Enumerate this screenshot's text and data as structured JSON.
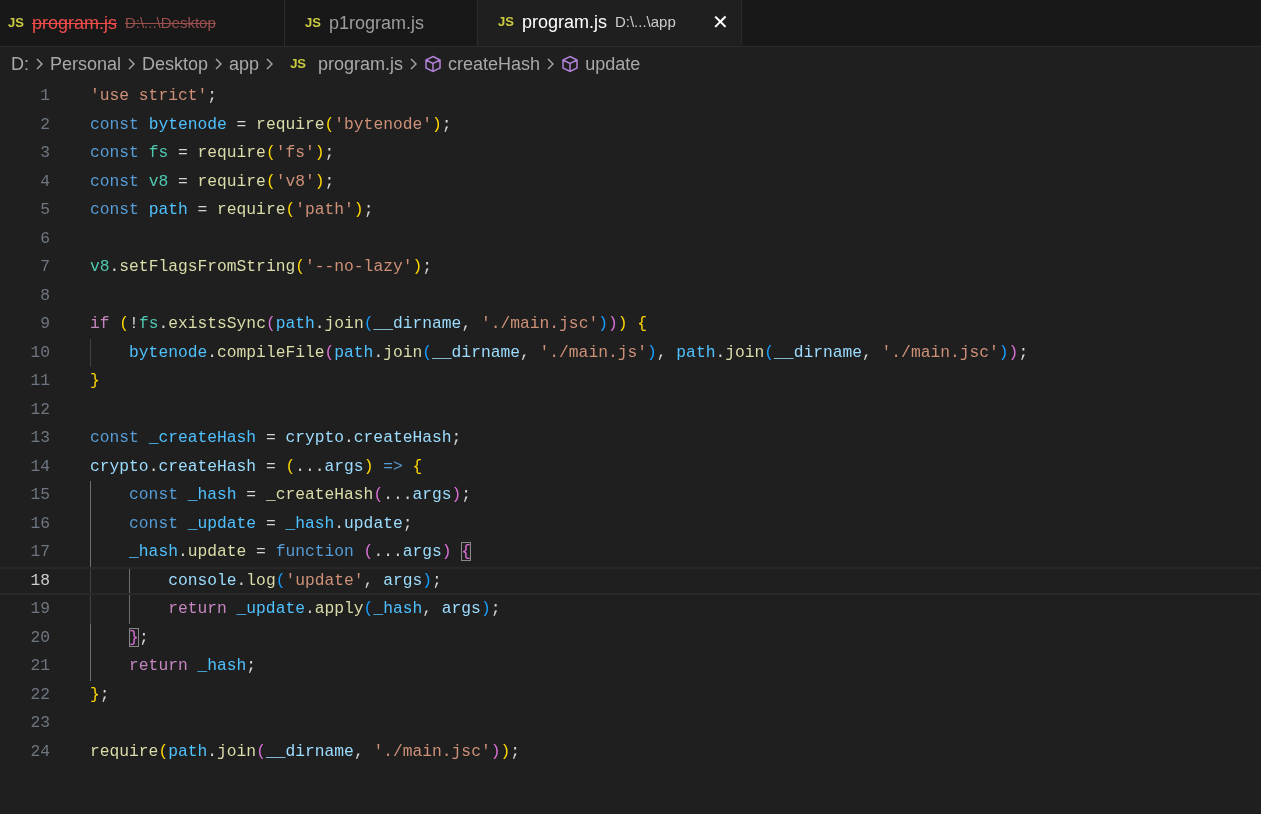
{
  "tabs": [
    {
      "icon": "JS",
      "name": "program.js",
      "path": "D:\\...\\Desktop",
      "selected": false,
      "deleted": true
    },
    {
      "icon": "JS",
      "name": "p1rogram.js",
      "selected": false,
      "deleted": false
    },
    {
      "icon": "JS",
      "name": "program.js",
      "path": "D:\\...\\app",
      "selected": true,
      "deleted": false,
      "close": "✕"
    }
  ],
  "breadcrumbs": [
    {
      "kind": "folder",
      "label": "D:"
    },
    {
      "kind": "folder",
      "label": "Personal"
    },
    {
      "kind": "folder",
      "label": "Desktop"
    },
    {
      "kind": "folder",
      "label": "app"
    },
    {
      "kind": "file",
      "icon": "JS",
      "label": "program.js"
    },
    {
      "kind": "symbol",
      "label": "createHash"
    },
    {
      "kind": "symbol",
      "label": "update"
    }
  ],
  "lines": [
    {
      "number": "1",
      "current": false,
      "tokens": [
        {
          "t": "'use strict'",
          "kind": "str"
        },
        {
          "t": ";",
          "kind": "p"
        }
      ]
    },
    {
      "number": "2",
      "current": false,
      "tokens": [
        {
          "t": "const ",
          "kind": "kw"
        },
        {
          "t": "bytenode",
          "kind": "cv"
        },
        {
          "t": " = ",
          "kind": "p"
        },
        {
          "t": "require",
          "kind": "fn"
        },
        {
          "t": "(",
          "kind": "b1"
        },
        {
          "t": "'bytenode'",
          "kind": "str"
        },
        {
          "t": ")",
          "kind": "b1"
        },
        {
          "t": ";",
          "kind": "p"
        }
      ]
    },
    {
      "number": "3",
      "current": false,
      "tokens": [
        {
          "t": "const ",
          "kind": "kw"
        },
        {
          "t": "fs",
          "kind": "ns"
        },
        {
          "t": " = ",
          "kind": "p"
        },
        {
          "t": "require",
          "kind": "fn"
        },
        {
          "t": "(",
          "kind": "b1"
        },
        {
          "t": "'fs'",
          "kind": "str"
        },
        {
          "t": ")",
          "kind": "b1"
        },
        {
          "t": ";",
          "kind": "p"
        }
      ]
    },
    {
      "number": "4",
      "current": false,
      "tokens": [
        {
          "t": "const ",
          "kind": "kw"
        },
        {
          "t": "v8",
          "kind": "ns"
        },
        {
          "t": " = ",
          "kind": "p"
        },
        {
          "t": "require",
          "kind": "fn"
        },
        {
          "t": "(",
          "kind": "b1"
        },
        {
          "t": "'v8'",
          "kind": "str"
        },
        {
          "t": ")",
          "kind": "b1"
        },
        {
          "t": ";",
          "kind": "p"
        }
      ]
    },
    {
      "number": "5",
      "current": false,
      "tokens": [
        {
          "t": "const ",
          "kind": "kw"
        },
        {
          "t": "path",
          "kind": "cv"
        },
        {
          "t": " = ",
          "kind": "p"
        },
        {
          "t": "require",
          "kind": "fn"
        },
        {
          "t": "(",
          "kind": "b1"
        },
        {
          "t": "'path'",
          "kind": "str"
        },
        {
          "t": ")",
          "kind": "b1"
        },
        {
          "t": ";",
          "kind": "p"
        }
      ]
    },
    {
      "number": "6",
      "current": false
    },
    {
      "number": "7",
      "current": false,
      "tokens": [
        {
          "t": "v8",
          "kind": "ns"
        },
        {
          "t": ".",
          "kind": "p"
        },
        {
          "t": "setFlagsFromString",
          "kind": "fn"
        },
        {
          "t": "(",
          "kind": "b1"
        },
        {
          "t": "'--no-lazy'",
          "kind": "str"
        },
        {
          "t": ")",
          "kind": "b1"
        },
        {
          "t": ";",
          "kind": "p"
        }
      ]
    },
    {
      "number": "8",
      "current": false
    },
    {
      "number": "9",
      "current": false,
      "tokens": [
        {
          "t": "if ",
          "kind": "ctl"
        },
        {
          "t": "(",
          "kind": "b1"
        },
        {
          "t": "!",
          "kind": "p"
        },
        {
          "t": "fs",
          "kind": "ns"
        },
        {
          "t": ".",
          "kind": "p"
        },
        {
          "t": "existsSync",
          "kind": "fn"
        },
        {
          "t": "(",
          "kind": "b2"
        },
        {
          "t": "path",
          "kind": "cv"
        },
        {
          "t": ".",
          "kind": "p"
        },
        {
          "t": "join",
          "kind": "fn"
        },
        {
          "t": "(",
          "kind": "b3"
        },
        {
          "t": "__dirname",
          "kind": "var"
        },
        {
          "t": ", ",
          "kind": "p"
        },
        {
          "t": "'./main.jsc'",
          "kind": "str"
        },
        {
          "t": ")",
          "kind": "b3"
        },
        {
          "t": ")",
          "kind": "b2"
        },
        {
          "t": ") ",
          "kind": "b1"
        },
        {
          "t": "{",
          "kind": "b1"
        }
      ]
    },
    {
      "number": "10",
      "current": false,
      "tokens": [
        {
          "t": "    bytenode",
          "kind": "cv"
        },
        {
          "t": ".",
          "kind": "p"
        },
        {
          "t": "compileFile",
          "kind": "fn"
        },
        {
          "t": "(",
          "kind": "b2"
        },
        {
          "t": "path",
          "kind": "cv"
        },
        {
          "t": ".",
          "kind": "p"
        },
        {
          "t": "join",
          "kind": "fn"
        },
        {
          "t": "(",
          "kind": "b3"
        },
        {
          "t": "__dirname",
          "kind": "var"
        },
        {
          "t": ", ",
          "kind": "p"
        },
        {
          "t": "'./main.js'",
          "kind": "str"
        },
        {
          "t": ")",
          "kind": "b3"
        },
        {
          "t": ", ",
          "kind": "p"
        },
        {
          "t": "path",
          "kind": "cv"
        },
        {
          "t": ".",
          "kind": "p"
        },
        {
          "t": "join",
          "kind": "fn"
        },
        {
          "t": "(",
          "kind": "b3"
        },
        {
          "t": "__dirname",
          "kind": "var"
        },
        {
          "t": ", ",
          "kind": "p"
        },
        {
          "t": "'./main.jsc'",
          "kind": "str"
        },
        {
          "t": ")",
          "kind": "b3"
        },
        {
          "t": ")",
          "kind": "b2"
        },
        {
          "t": ";",
          "kind": "p"
        }
      ]
    },
    {
      "number": "11",
      "current": false,
      "tokens": [
        {
          "t": "}",
          "kind": "b1"
        }
      ]
    },
    {
      "number": "12",
      "current": false
    },
    {
      "number": "13",
      "current": false,
      "tokens": [
        {
          "t": "const ",
          "kind": "kw"
        },
        {
          "t": "_createHash",
          "kind": "cv"
        },
        {
          "t": " = ",
          "kind": "p"
        },
        {
          "t": "crypto",
          "kind": "var"
        },
        {
          "t": ".",
          "kind": "p"
        },
        {
          "t": "createHash",
          "kind": "var"
        },
        {
          "t": ";",
          "kind": "p"
        }
      ]
    },
    {
      "number": "14",
      "current": false,
      "tokens": [
        {
          "t": "crypto",
          "kind": "var"
        },
        {
          "t": ".",
          "kind": "p"
        },
        {
          "t": "createHash",
          "kind": "var"
        },
        {
          "t": " = ",
          "kind": "p"
        },
        {
          "t": "(",
          "kind": "b1"
        },
        {
          "t": "...",
          "kind": "p"
        },
        {
          "t": "args",
          "kind": "var"
        },
        {
          "t": ") ",
          "kind": "b1"
        },
        {
          "t": "=> ",
          "kind": "kw"
        },
        {
          "t": "{",
          "kind": "b1"
        }
      ]
    },
    {
      "number": "15",
      "current": false,
      "tokens": [
        {
          "t": "    const ",
          "kind": "kw"
        },
        {
          "t": "_hash",
          "kind": "cv"
        },
        {
          "t": " = ",
          "kind": "p"
        },
        {
          "t": "_createHash",
          "kind": "fn"
        },
        {
          "t": "(",
          "kind": "b2"
        },
        {
          "t": "...",
          "kind": "p"
        },
        {
          "t": "args",
          "kind": "var"
        },
        {
          "t": ")",
          "kind": "b2"
        },
        {
          "t": ";",
          "kind": "p"
        }
      ]
    },
    {
      "number": "16",
      "current": false,
      "tokens": [
        {
          "t": "    const ",
          "kind": "kw"
        },
        {
          "t": "_update",
          "kind": "cv"
        },
        {
          "t": " = ",
          "kind": "p"
        },
        {
          "t": "_hash",
          "kind": "cv"
        },
        {
          "t": ".",
          "kind": "p"
        },
        {
          "t": "update",
          "kind": "var"
        },
        {
          "t": ";",
          "kind": "p"
        }
      ]
    },
    {
      "number": "17",
      "current": false,
      "tokens": [
        {
          "t": "    _hash",
          "kind": "cv"
        },
        {
          "t": ".",
          "kind": "p"
        },
        {
          "t": "update",
          "kind": "fn"
        },
        {
          "t": " = ",
          "kind": "p"
        },
        {
          "t": "function ",
          "kind": "kw"
        },
        {
          "t": "(",
          "kind": "b2"
        },
        {
          "t": "...",
          "kind": "p"
        },
        {
          "t": "args",
          "kind": "var"
        },
        {
          "t": ") ",
          "kind": "b2"
        },
        {
          "t": "{",
          "kind": "b2m"
        }
      ]
    },
    {
      "number": "18",
      "current": true,
      "tokens": [
        {
          "t": "        console",
          "kind": "var"
        },
        {
          "t": ".",
          "kind": "p"
        },
        {
          "t": "log",
          "kind": "fn"
        },
        {
          "t": "(",
          "kind": "b3"
        },
        {
          "t": "'update'",
          "kind": "str"
        },
        {
          "t": ", ",
          "kind": "p"
        },
        {
          "t": "args",
          "kind": "var"
        },
        {
          "t": ")",
          "kind": "b3"
        },
        {
          "t": ";",
          "kind": "p"
        }
      ]
    },
    {
      "number": "19",
      "current": false,
      "tokens": [
        {
          "t": "        return ",
          "kind": "ctl"
        },
        {
          "t": "_update",
          "kind": "cv"
        },
        {
          "t": ".",
          "kind": "p"
        },
        {
          "t": "apply",
          "kind": "fn"
        },
        {
          "t": "(",
          "kind": "b3"
        },
        {
          "t": "_hash",
          "kind": "cv"
        },
        {
          "t": ", ",
          "kind": "p"
        },
        {
          "t": "args",
          "kind": "var"
        },
        {
          "t": ")",
          "kind": "b3"
        },
        {
          "t": ";",
          "kind": "p"
        }
      ]
    },
    {
      "number": "20",
      "current": false,
      "tokens": [
        {
          "t": "    }",
          "kind": "b2m"
        },
        {
          "t": ";",
          "kind": "p"
        }
      ]
    },
    {
      "number": "21",
      "current": false,
      "tokens": [
        {
          "t": "    return ",
          "kind": "ctl"
        },
        {
          "t": "_hash",
          "kind": "cv"
        },
        {
          "t": ";",
          "kind": "p"
        }
      ]
    },
    {
      "number": "22",
      "current": false,
      "tokens": [
        {
          "t": "}",
          "kind": "b1"
        },
        {
          "t": ";",
          "kind": "p"
        }
      ]
    },
    {
      "number": "23",
      "current": false
    },
    {
      "number": "24",
      "current": false,
      "tokens": [
        {
          "t": "require",
          "kind": "fn"
        },
        {
          "t": "(",
          "kind": "b1"
        },
        {
          "t": "path",
          "kind": "cv"
        },
        {
          "t": ".",
          "kind": "p"
        },
        {
          "t": "join",
          "kind": "fn"
        },
        {
          "t": "(",
          "kind": "b2"
        },
        {
          "t": "__dirname",
          "kind": "var"
        },
        {
          "t": ", ",
          "kind": "p"
        },
        {
          "t": "'./main.jsc'",
          "kind": "str"
        },
        {
          "t": ")",
          "kind": "b2"
        },
        {
          "t": ")",
          "kind": "b1"
        },
        {
          "t": ";",
          "kind": "p"
        }
      ]
    }
  ]
}
